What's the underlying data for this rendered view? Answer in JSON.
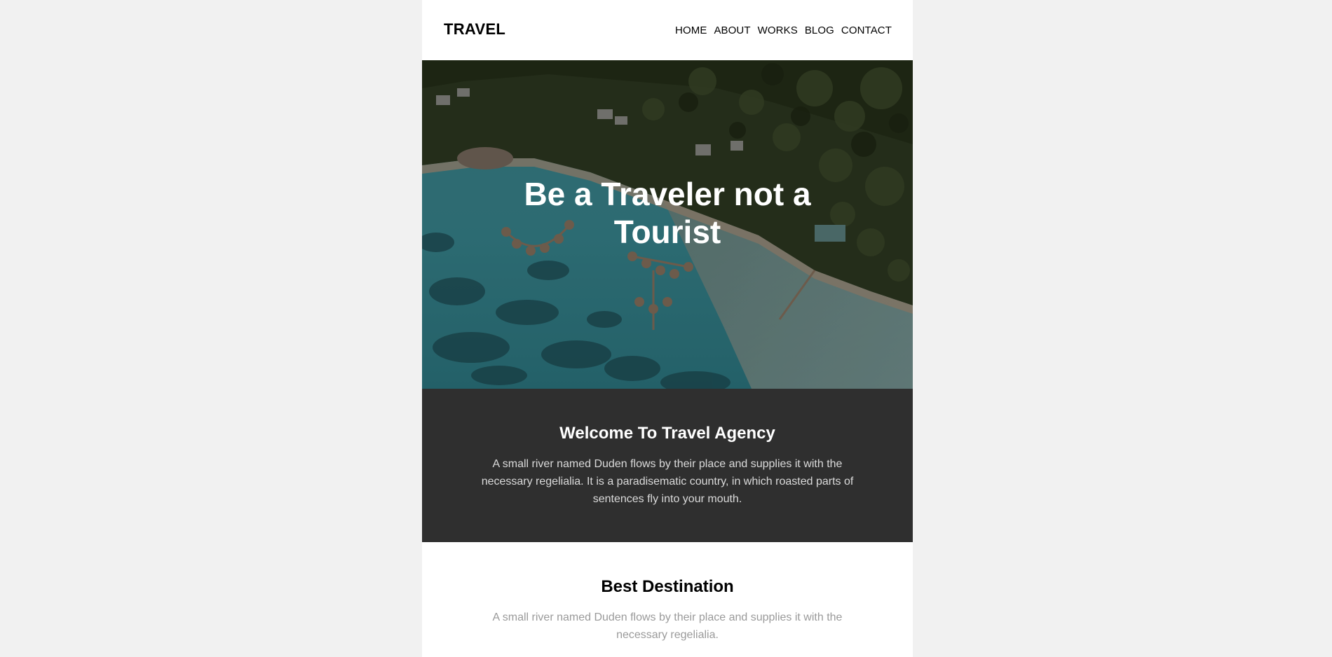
{
  "header": {
    "logo": "TRAVEL",
    "nav": [
      {
        "label": "HOME"
      },
      {
        "label": "ABOUT"
      },
      {
        "label": "WORKS"
      },
      {
        "label": "BLOG"
      },
      {
        "label": "CONTACT"
      }
    ]
  },
  "hero": {
    "title": "Be a Traveler not a Tourist",
    "image": "aerial-resort-lagoon-image"
  },
  "welcome": {
    "title": "Welcome To Travel Agency",
    "text": "A small river named Duden flows by their place and supplies it with the necessary regelialia. It is a paradisematic country, in which roasted parts of sentences fly into your mouth."
  },
  "destination": {
    "title": "Best Destination",
    "text": "A small river named Duden flows by their place and supplies it with the necessary regelialia."
  },
  "colors": {
    "page_bg": "#f1f1f1",
    "welcome_bg": "#2f2f2f",
    "muted_text": "#9a9a9a"
  }
}
